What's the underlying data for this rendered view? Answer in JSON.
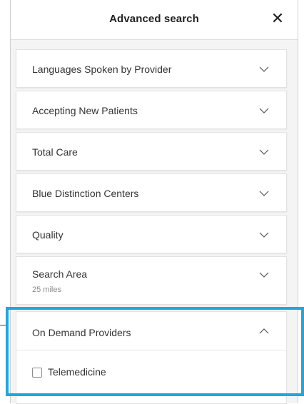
{
  "header": {
    "title": "Advanced search",
    "close_glyph": "✕"
  },
  "filters": [
    {
      "label": "Languages Spoken by Provider",
      "expanded": false
    },
    {
      "label": "Accepting New Patients",
      "expanded": false
    },
    {
      "label": "Total Care",
      "expanded": false
    },
    {
      "label": "Blue Distinction Centers",
      "expanded": false
    },
    {
      "label": "Quality",
      "expanded": false
    },
    {
      "label": "Search Area",
      "sub": "25 miles",
      "expanded": false
    },
    {
      "label": "On Demand Providers",
      "expanded": true,
      "options": [
        {
          "label": "Telemedicine",
          "checked": false
        }
      ]
    }
  ],
  "colors": {
    "highlight": "#1ea7dc",
    "panel_bg": "#f4f4f4"
  }
}
